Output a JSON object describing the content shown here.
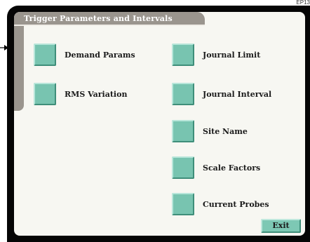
{
  "page": {
    "corner_label": "EP13"
  },
  "screen": {
    "title": "Trigger Parameters and Intervals",
    "exit_label": "Exit"
  },
  "buttons": [
    {
      "label": "Demand Params",
      "icon": "button-square"
    },
    {
      "label": "RMS Variation",
      "icon": "button-square"
    },
    {
      "label": "Journal Limit",
      "icon": "button-square"
    },
    {
      "label": "Journal Interval",
      "icon": "button-square"
    },
    {
      "label": "Site Name",
      "icon": "button-square"
    },
    {
      "label": "Scale Factors",
      "icon": "button-square"
    },
    {
      "label": "Current Probes",
      "icon": "button-square"
    }
  ],
  "colors": {
    "button_face": "#78c4b0",
    "tab_gray": "#9a958e",
    "frame": "#050505",
    "screen_bg": "#f7f7f2"
  }
}
